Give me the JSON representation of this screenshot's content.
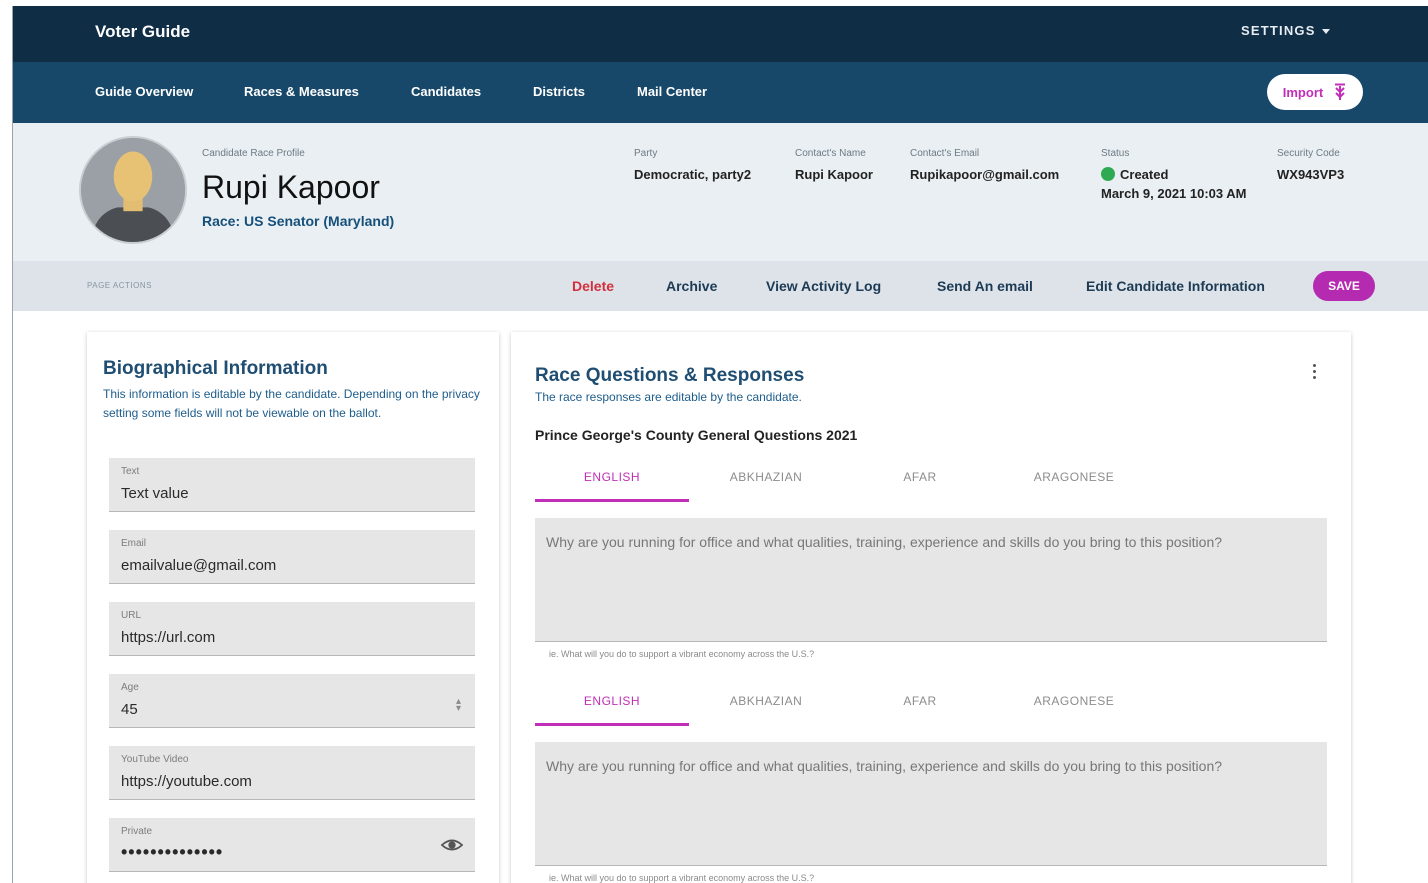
{
  "app": {
    "title": "Voter Guide",
    "settings_label": "SETTINGS"
  },
  "nav": {
    "items": [
      "Guide Overview",
      "Races & Measures",
      "Candidates",
      "Districts",
      "Mail Center"
    ],
    "import_label": "Import"
  },
  "profile": {
    "subtitle": "Candidate Race Profile",
    "name": "Rupi Kapoor",
    "race": "Race: US Senator (Maryland)",
    "party_label": "Party",
    "party": "Democratic, party2",
    "contact_name_label": "Contact's Name",
    "contact_name": "Rupi Kapoor",
    "contact_email_label": "Contact's Email",
    "contact_email": "Rupikapoor@gmail.com",
    "status_label": "Status",
    "status": "Created",
    "status_date": "March 9, 2021 10:03 AM",
    "status_color": "#2eaa52",
    "security_label": "Security Code",
    "security_code": "WX943VP3"
  },
  "actions": {
    "label": "PAGE ACTIONS",
    "delete": "Delete",
    "archive": "Archive",
    "activity_log": "View Activity Log",
    "send_email": "Send An email",
    "edit_info": "Edit Candidate Information",
    "save": "SAVE"
  },
  "bio": {
    "title": "Biographical Information",
    "description": "This information is editable by the candidate. Depending on the privacy setting some fields will not be viewable on the ballot.",
    "fields": [
      {
        "label": "Text",
        "value": "Text value"
      },
      {
        "label": "Email",
        "value": "emailvalue@gmail.com"
      },
      {
        "label": "URL",
        "value": "https://url.com"
      },
      {
        "label": "Age",
        "value": "45"
      },
      {
        "label": "YouTube Video",
        "value": "https://youtube.com"
      },
      {
        "label": "Private",
        "value": "••••••••••••••"
      }
    ]
  },
  "race_questions": {
    "title": "Race Questions & Responses",
    "description": "The race responses are editable by the candidate.",
    "section": "Prince George's County General Questions 2021",
    "languages": [
      "ENGLISH",
      "ABKHAZIAN",
      "AFAR",
      "ARAGONESE"
    ],
    "questions": [
      {
        "placeholder": "Why are you running for office and what qualities, training, experience and skills do you bring to this position?",
        "hint": "ie. What will you do to support a vibrant economy across the U.S.?"
      },
      {
        "placeholder": "Why are you running for office and what qualities, training, experience and skills do you bring to this position?",
        "hint": "ie. What will you do to support a vibrant economy across the U.S.?"
      }
    ]
  },
  "colors": {
    "topbar": "#0f2d45",
    "navbar": "#17486a",
    "accent": "#c12fb8",
    "danger": "#d32f3c"
  }
}
